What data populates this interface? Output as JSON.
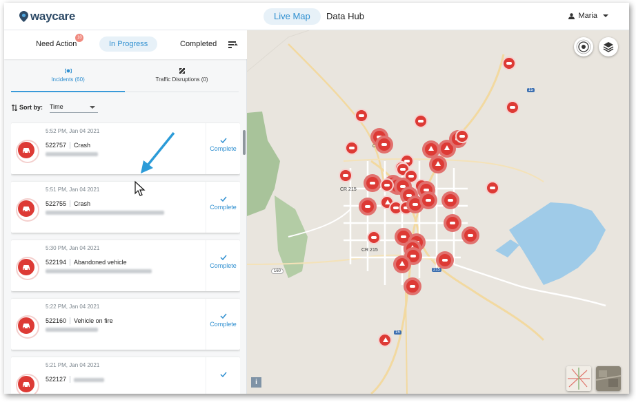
{
  "app": {
    "brand": "waycare"
  },
  "nav": {
    "live_map": "Live Map",
    "data_hub": "Data Hub"
  },
  "user": {
    "name": "Maria",
    "icon": "person-icon"
  },
  "status_tabs": {
    "need_action": "Need Action",
    "need_action_badge": "10",
    "in_progress": "In Progress",
    "completed": "Completed"
  },
  "type_tabs": {
    "incidents": "Incidents (60)",
    "disruptions": "Traffic Disruptions (0)"
  },
  "sort": {
    "label": "Sort by:",
    "value": "Time"
  },
  "incidents": [
    {
      "time": "5:52 PM, Jan 04 2021",
      "id": "522757",
      "type": "Crash",
      "action": "Complete"
    },
    {
      "time": "5:51 PM, Jan 04 2021",
      "id": "522755",
      "type": "Crash",
      "action": "Complete"
    },
    {
      "time": "5:30 PM, Jan 04 2021",
      "id": "522194",
      "type": "Abandoned vehicle",
      "action": "Complete"
    },
    {
      "time": "5:22 PM, Jan 04 2021",
      "id": "522160",
      "type": "Vehicle on fire",
      "action": "Complete"
    },
    {
      "time": "5:21 PM, Jan 04 2021",
      "id": "522127",
      "type": "",
      "action": ""
    }
  ],
  "map": {
    "labels": {
      "cr215_a": "CR 215",
      "cr215_b": "CR 215",
      "cr215_c": "CR 215",
      "i15_a": "15",
      "i15_b": "15",
      "i15_c": "15",
      "r160": "160",
      "i215": "215"
    },
    "info": "i",
    "colors": {
      "accent": "#2f8fd0",
      "incident": "#dd3a35",
      "water": "#9fcbe8",
      "park": "#a8c39a"
    }
  }
}
